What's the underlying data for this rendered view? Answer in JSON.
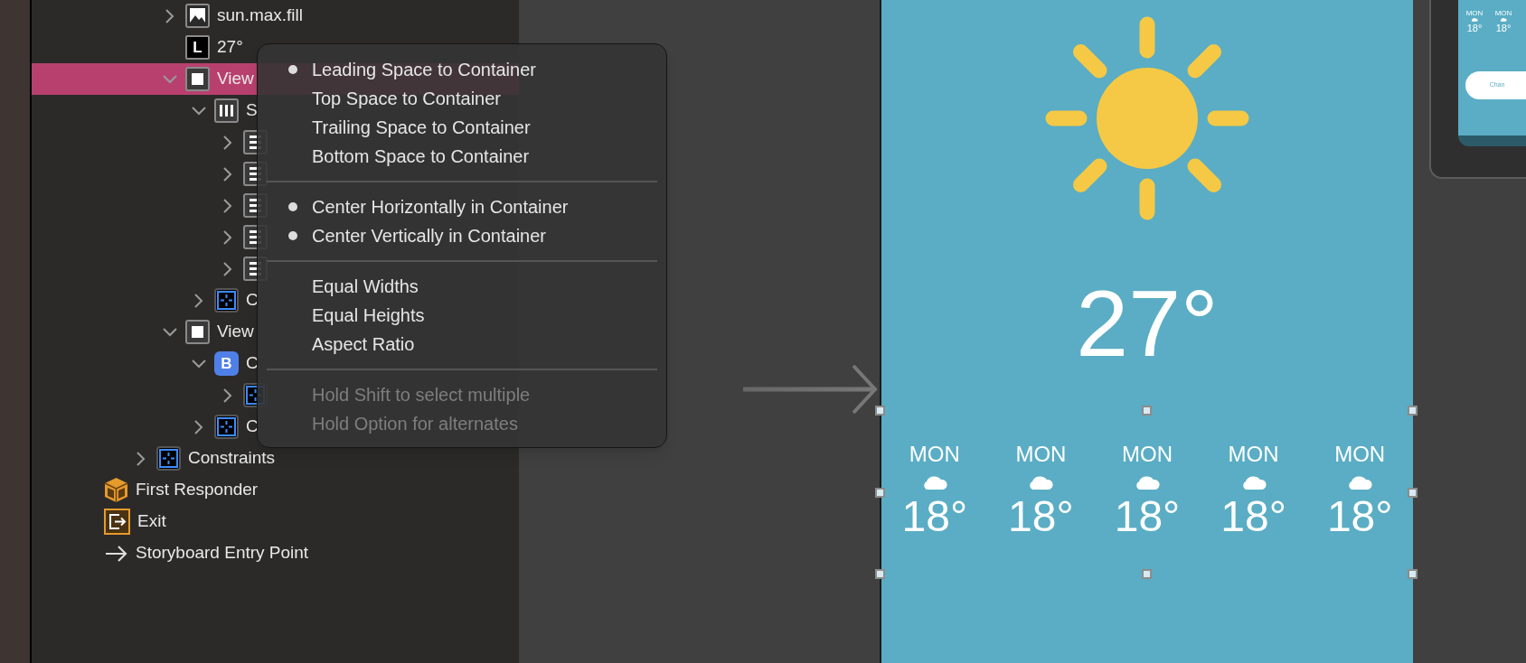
{
  "outline": {
    "items": [
      {
        "kind": "continued",
        "children": [
          {
            "kind": "continued",
            "children": [
              {
                "kind": "image",
                "label": "sun.max.fill",
                "expanded": false,
                "selected": false
              },
              {
                "kind": "label",
                "badge": "L",
                "label": "27°",
                "selected": false
              },
              {
                "kind": "view",
                "label": "View",
                "expanded": true,
                "selected": true,
                "children": [
                  {
                    "kind": "stack-horizontal",
                    "label": "S",
                    "expanded": true,
                    "selected": false,
                    "children": [
                      {
                        "kind": "stack-vertical",
                        "expanded": false,
                        "selected": false
                      },
                      {
                        "kind": "stack-vertical",
                        "expanded": false,
                        "selected": false
                      },
                      {
                        "kind": "stack-vertical",
                        "expanded": false,
                        "selected": false
                      },
                      {
                        "kind": "stack-vertical",
                        "expanded": false,
                        "selected": false
                      },
                      {
                        "kind": "stack-vertical",
                        "expanded": false,
                        "selected": false
                      }
                    ]
                  },
                  {
                    "kind": "constraints",
                    "label": "C",
                    "expanded": false,
                    "selected": false
                  }
                ]
              },
              {
                "kind": "view",
                "label": "View",
                "expanded": true,
                "selected": false,
                "children": [
                  {
                    "kind": "button",
                    "badge": "B",
                    "label": "C",
                    "expanded": true,
                    "selected": false,
                    "children": [
                      {
                        "kind": "constraints",
                        "expanded": false,
                        "selected": false
                      }
                    ]
                  },
                  {
                    "kind": "constraints",
                    "label": "C",
                    "expanded": false,
                    "selected": false
                  }
                ]
              }
            ]
          },
          {
            "kind": "constraints",
            "label": "Constraints",
            "expanded": false,
            "selected": false
          }
        ]
      },
      {
        "kind": "first-responder",
        "label": "First Responder",
        "selected": false
      },
      {
        "kind": "exit",
        "label": "Exit",
        "selected": false
      },
      {
        "kind": "entry-point",
        "label": "Storyboard Entry Point",
        "selected": false
      }
    ]
  },
  "menu": {
    "sections": [
      {
        "items": [
          {
            "label": "Leading Space to Container",
            "checked": true,
            "disabled": false
          },
          {
            "label": "Top Space to Container",
            "checked": false,
            "disabled": false
          },
          {
            "label": "Trailing Space to Container",
            "checked": false,
            "disabled": false
          },
          {
            "label": "Bottom Space to Container",
            "checked": false,
            "disabled": false
          }
        ]
      },
      {
        "items": [
          {
            "label": "Center Horizontally in Container",
            "checked": true,
            "disabled": false
          },
          {
            "label": "Center Vertically in Container",
            "checked": true,
            "disabled": false
          }
        ]
      },
      {
        "items": [
          {
            "label": "Equal Widths",
            "checked": false,
            "disabled": false
          },
          {
            "label": "Equal Heights",
            "checked": false,
            "disabled": false
          },
          {
            "label": "Aspect Ratio",
            "checked": false,
            "disabled": false
          }
        ]
      },
      {
        "items": [
          {
            "label": "Hold Shift to select multiple",
            "checked": false,
            "disabled": true
          },
          {
            "label": "Hold Option for alternates",
            "checked": false,
            "disabled": true
          }
        ]
      }
    ]
  },
  "screen": {
    "temperature": "27°",
    "forecast": [
      {
        "day": "MON",
        "temp": "18°"
      },
      {
        "day": "MON",
        "temp": "18°"
      },
      {
        "day": "MON",
        "temp": "18°"
      },
      {
        "day": "MON",
        "temp": "18°"
      },
      {
        "day": "MON",
        "temp": "18°"
      }
    ]
  },
  "preview": {
    "forecast": [
      {
        "day": "MON",
        "temp": "18°"
      },
      {
        "day": "MON",
        "temp": "18°"
      }
    ],
    "button": "Chan"
  }
}
